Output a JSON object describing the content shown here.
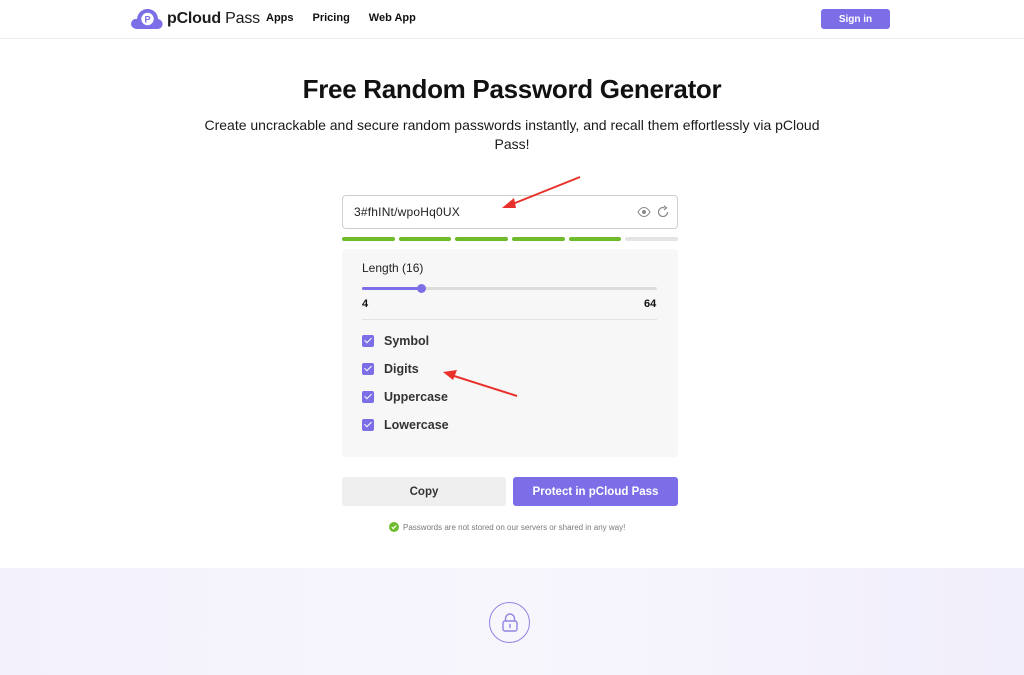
{
  "header": {
    "brand_strong": "pCloud",
    "brand_light": " Pass",
    "nav": [
      "Apps",
      "Pricing",
      "Web App"
    ],
    "signin_label": "Sign in"
  },
  "hero": {
    "title": "Free Random Password Generator",
    "subtitle": "Create uncrackable and secure random passwords instantly, and recall them effortlessly via pCloud Pass!"
  },
  "generator": {
    "password": "3#fhINt/wpoHq0UX",
    "strength_segments_total": 6,
    "strength_segments_filled": 5,
    "length_label": "Length (16)",
    "length_value": 16,
    "length_min": "4",
    "length_max": "64",
    "options": [
      {
        "label": "Symbol",
        "checked": true
      },
      {
        "label": "Digits",
        "checked": true
      },
      {
        "label": "Uppercase",
        "checked": true
      },
      {
        "label": "Lowercase",
        "checked": true
      }
    ],
    "copy_label": "Copy",
    "protect_label": "Protect in pCloud Pass",
    "note": "Passwords are not stored on our servers or shared in any way!"
  },
  "colors": {
    "accent": "#7b6ee6",
    "strength": "#6ebb2c",
    "annotation_arrow": "#e8312a"
  },
  "icons": {
    "logo": "cloud-p-logo-icon",
    "eye": "eye-icon",
    "refresh": "refresh-icon",
    "note": "check-shield-icon",
    "lock": "lock-icon"
  }
}
